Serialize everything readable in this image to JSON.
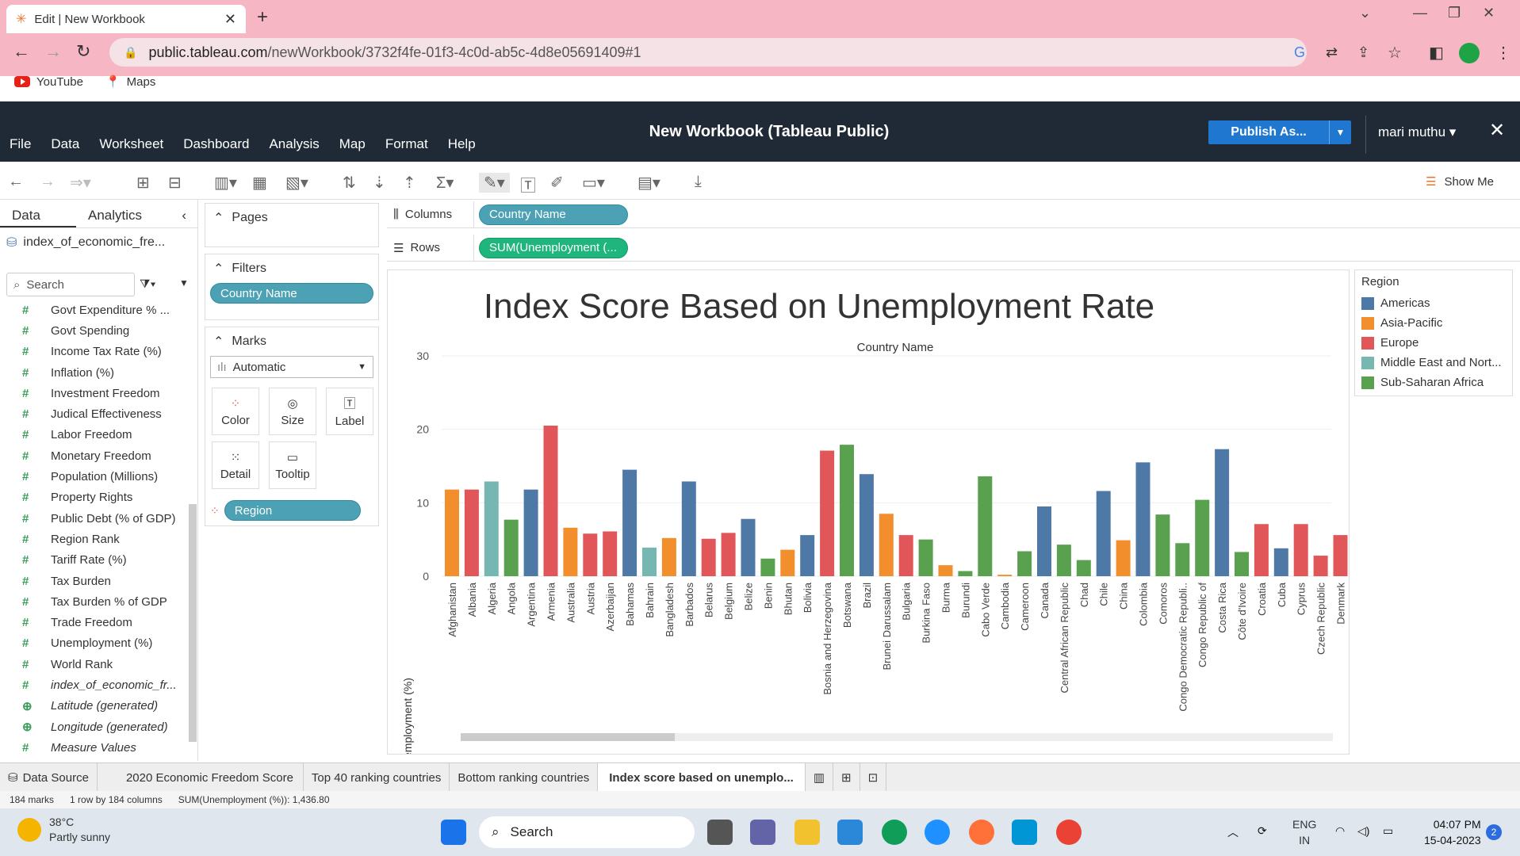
{
  "browser": {
    "tab_title": "Edit | New Workbook",
    "url_host": "public.tableau.com",
    "url_path": "/newWorkbook/3732f4fe-01f3-4c0d-ab5c-4d8e05691409#1",
    "bookmarks": [
      "YouTube",
      "Maps"
    ]
  },
  "app": {
    "title": "New Workbook (Tableau Public)",
    "menu": [
      "File",
      "Data",
      "Worksheet",
      "Dashboard",
      "Analysis",
      "Map",
      "Format",
      "Help"
    ],
    "publish_label": "Publish As...",
    "user": "mari muthu",
    "show_me": "Show Me"
  },
  "left_pane": {
    "tabs": [
      "Data",
      "Analytics"
    ],
    "datasource": "index_of_economic_fre...",
    "search_placeholder": "Search",
    "fields": [
      {
        "name": "Govt Expenditure % ...",
        "type": "measure"
      },
      {
        "name": "Govt Spending",
        "type": "measure"
      },
      {
        "name": "Income Tax Rate (%)",
        "type": "measure"
      },
      {
        "name": "Inflation (%)",
        "type": "measure"
      },
      {
        "name": "Investment Freedom",
        "type": "measure"
      },
      {
        "name": "Judical Effectiveness",
        "type": "measure"
      },
      {
        "name": "Labor Freedom",
        "type": "measure"
      },
      {
        "name": "Monetary Freedom",
        "type": "measure"
      },
      {
        "name": "Population (Millions)",
        "type": "measure"
      },
      {
        "name": "Property Rights",
        "type": "measure"
      },
      {
        "name": "Public Debt (% of GDP)",
        "type": "measure"
      },
      {
        "name": "Region Rank",
        "type": "measure"
      },
      {
        "name": "Tariff Rate (%)",
        "type": "measure"
      },
      {
        "name": "Tax Burden",
        "type": "measure"
      },
      {
        "name": "Tax Burden % of GDP",
        "type": "measure"
      },
      {
        "name": "Trade Freedom",
        "type": "measure"
      },
      {
        "name": "Unemployment (%)",
        "type": "measure"
      },
      {
        "name": "World Rank",
        "type": "measure"
      },
      {
        "name": "index_of_economic_fr...",
        "type": "measure-italic"
      },
      {
        "name": "Latitude (generated)",
        "type": "geo"
      },
      {
        "name": "Longitude (generated)",
        "type": "geo"
      },
      {
        "name": "Measure Values",
        "type": "measure-italic"
      }
    ]
  },
  "cards": {
    "pages": "Pages",
    "filters": "Filters",
    "filter_pill": "Country Name",
    "marks": "Marks",
    "mark_type": "Automatic",
    "mark_buttons": [
      "Color",
      "Size",
      "Label",
      "Detail",
      "Tooltip"
    ],
    "color_pill": "Region"
  },
  "shelves": {
    "columns_label": "Columns",
    "columns_pill": "Country Name",
    "rows_label": "Rows",
    "rows_pill": "SUM(Unemployment (..."
  },
  "legend": {
    "title": "Region",
    "items": [
      {
        "label": "Americas",
        "color": "#4e79a7"
      },
      {
        "label": "Asia-Pacific",
        "color": "#f28e2b"
      },
      {
        "label": "Europe",
        "color": "#e15759"
      },
      {
        "label": "Middle East and Nort...",
        "color": "#76b7b2"
      },
      {
        "label": "Sub-Saharan Africa",
        "color": "#59a14f"
      }
    ]
  },
  "chart_data": {
    "type": "bar",
    "title": "Index Score Based on Unemployment Rate",
    "xlabel": "Country Name",
    "ylabel": "Unemployment (%)",
    "ylim": [
      0,
      30
    ],
    "yticks": [
      0,
      10,
      20,
      30
    ],
    "categories": [
      "Afghanistan",
      "Albania",
      "Algeria",
      "Angola",
      "Argentina",
      "Armenia",
      "Australia",
      "Austria",
      "Azerbaijan",
      "Bahamas",
      "Bahrain",
      "Bangladesh",
      "Barbados",
      "Belarus",
      "Belgium",
      "Belize",
      "Benin",
      "Bhutan",
      "Bolivia",
      "Bosnia and Herzegovina",
      "Botswana",
      "Brazil",
      "Brunei Darussalam",
      "Bulgaria",
      "Burkina Faso",
      "Burma",
      "Burundi",
      "Cabo Verde",
      "Cambodia",
      "Cameroon",
      "Canada",
      "Central African Republic",
      "Chad",
      "Chile",
      "China",
      "Colombia",
      "Comoros",
      "Congo Democratic Republi..",
      "Congo Republic of",
      "Costa Rica",
      "Côte d'Ivoire",
      "Croatia",
      "Cuba",
      "Cyprus",
      "Czech Republic",
      "Denmark"
    ],
    "regions": [
      "Asia-Pacific",
      "Europe",
      "Middle East and Nort...",
      "Sub-Saharan Africa",
      "Americas",
      "Europe",
      "Asia-Pacific",
      "Europe",
      "Europe",
      "Americas",
      "Middle East and Nort...",
      "Asia-Pacific",
      "Americas",
      "Europe",
      "Europe",
      "Americas",
      "Sub-Saharan Africa",
      "Asia-Pacific",
      "Americas",
      "Europe",
      "Sub-Saharan Africa",
      "Americas",
      "Asia-Pacific",
      "Europe",
      "Sub-Saharan Africa",
      "Asia-Pacific",
      "Sub-Saharan Africa",
      "Sub-Saharan Africa",
      "Asia-Pacific",
      "Sub-Saharan Africa",
      "Americas",
      "Sub-Saharan Africa",
      "Sub-Saharan Africa",
      "Americas",
      "Asia-Pacific",
      "Americas",
      "Sub-Saharan Africa",
      "Sub-Saharan Africa",
      "Sub-Saharan Africa",
      "Americas",
      "Sub-Saharan Africa",
      "Europe",
      "Americas",
      "Europe",
      "Europe",
      "Europe"
    ],
    "values": [
      11.8,
      11.8,
      12.9,
      7.7,
      11.8,
      20.5,
      6.6,
      5.8,
      6.1,
      14.5,
      3.9,
      5.2,
      12.9,
      5.1,
      5.9,
      7.8,
      2.4,
      3.6,
      5.6,
      17.1,
      17.9,
      13.9,
      8.5,
      5.6,
      5.0,
      1.5,
      0.7,
      13.6,
      0.2,
      3.4,
      9.5,
      4.3,
      2.2,
      11.6,
      4.9,
      15.5,
      8.4,
      4.5,
      10.4,
      17.3,
      3.3,
      7.1,
      3.8,
      7.1,
      2.8,
      5.6
    ],
    "grid": true,
    "legend": "right"
  },
  "sheet_tabs": [
    "Data Source",
    "2020 Economic Freedom Score",
    "Top 40 ranking countries",
    "Bottom ranking countries",
    "Index score based on unemplo..."
  ],
  "status_bar": {
    "marks": "184 marks",
    "layout": "1 row by 184 columns",
    "sum": "SUM(Unemployment (%)): 1,436.80"
  },
  "taskbar": {
    "temp": "38°C",
    "weather": "Partly sunny",
    "search": "Search",
    "lang1": "ENG",
    "lang2": "IN",
    "time": "04:07 PM",
    "date": "15-04-2023",
    "badge": "2"
  }
}
